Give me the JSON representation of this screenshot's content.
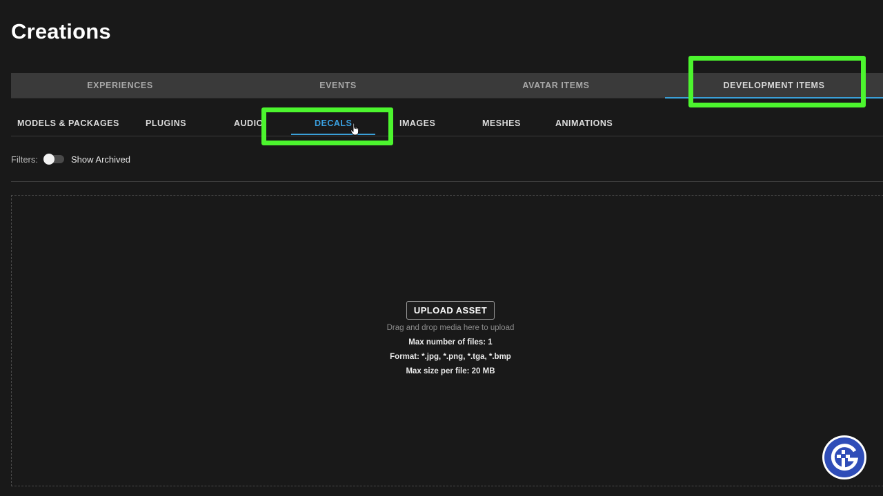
{
  "page": {
    "title": "Creations"
  },
  "top_tabs": [
    {
      "label": "EXPERIENCES",
      "active": false
    },
    {
      "label": "EVENTS",
      "active": false
    },
    {
      "label": "AVATAR ITEMS",
      "active": false
    },
    {
      "label": "DEVELOPMENT ITEMS",
      "active": true
    }
  ],
  "sub_tabs": [
    {
      "label": "MODELS & PACKAGES",
      "active": false
    },
    {
      "label": "PLUGINS",
      "active": false
    },
    {
      "label": "AUDIO",
      "active": false
    },
    {
      "label": "DECALS",
      "active": true
    },
    {
      "label": "IMAGES",
      "active": false
    },
    {
      "label": "MESHES",
      "active": false
    },
    {
      "label": "ANIMATIONS",
      "active": false
    }
  ],
  "filters": {
    "label": "Filters:",
    "show_archived_label": "Show Archived",
    "show_archived_on": false
  },
  "upload": {
    "button_label": "UPLOAD ASSET",
    "hint": "Drag and drop media here to upload",
    "max_files": "Max number of files: 1",
    "formats": "Format: *.jpg, *.png, *.tga, *.bmp",
    "max_size": "Max size per file: 20 MB"
  },
  "colors": {
    "accent": "#3aa0d8",
    "highlight_annotation": "#4cf52e",
    "background": "#191919",
    "tab_bar": "#3a3a3a"
  },
  "icons": {
    "cursor": "hand-pointer-icon",
    "watermark": "site-logo-icon"
  }
}
